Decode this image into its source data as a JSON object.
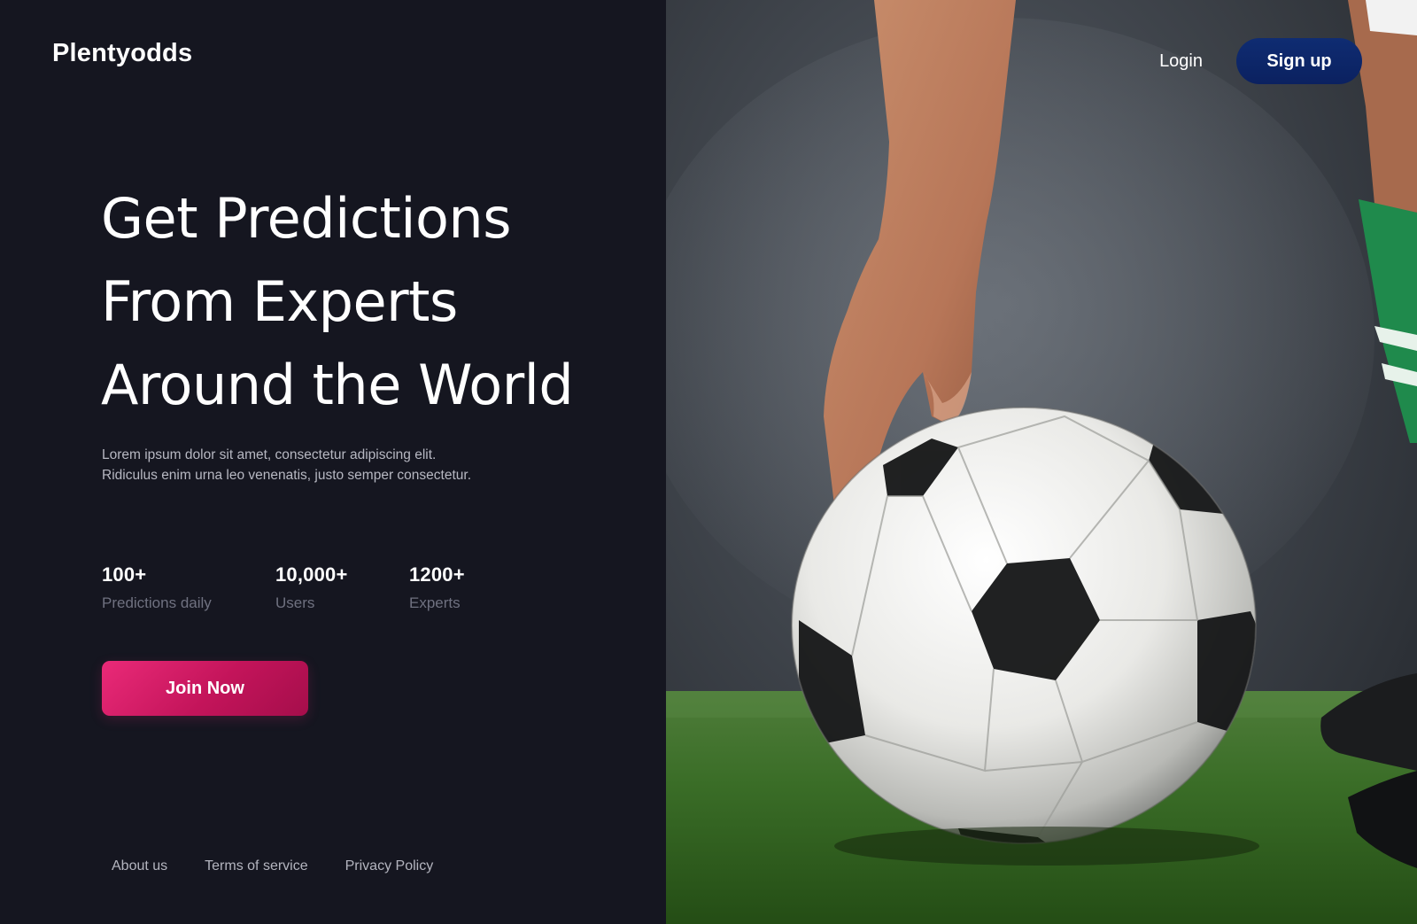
{
  "brand": {
    "name": "Plentyodds"
  },
  "nav": {
    "login_label": "Login",
    "signup_label": "Sign up"
  },
  "hero": {
    "title_lines": [
      "Get Predictions",
      "From Experts",
      "Around the World"
    ],
    "subtitle_lines": [
      "Lorem ipsum dolor sit amet, consectetur adipiscing elit.",
      "Ridiculus enim urna leo venenatis, justo semper consectetur."
    ],
    "cta_label": "Join Now"
  },
  "stats": [
    {
      "value": "100+",
      "label": "Predictions daily"
    },
    {
      "value": "10,000+",
      "label": "Users"
    },
    {
      "value": "1200+",
      "label": "Experts"
    }
  ],
  "footer": {
    "links": [
      "About us",
      "Terms of service",
      "Privacy Policy"
    ]
  },
  "colors": {
    "background": "#151620",
    "cta_pink": "#d81b66",
    "signup_navy": "#0d2566",
    "muted_text": "#6f7180",
    "grass_green": "#3d7a2a"
  },
  "icons": {
    "hero_image": "soccer-ball-photo"
  }
}
